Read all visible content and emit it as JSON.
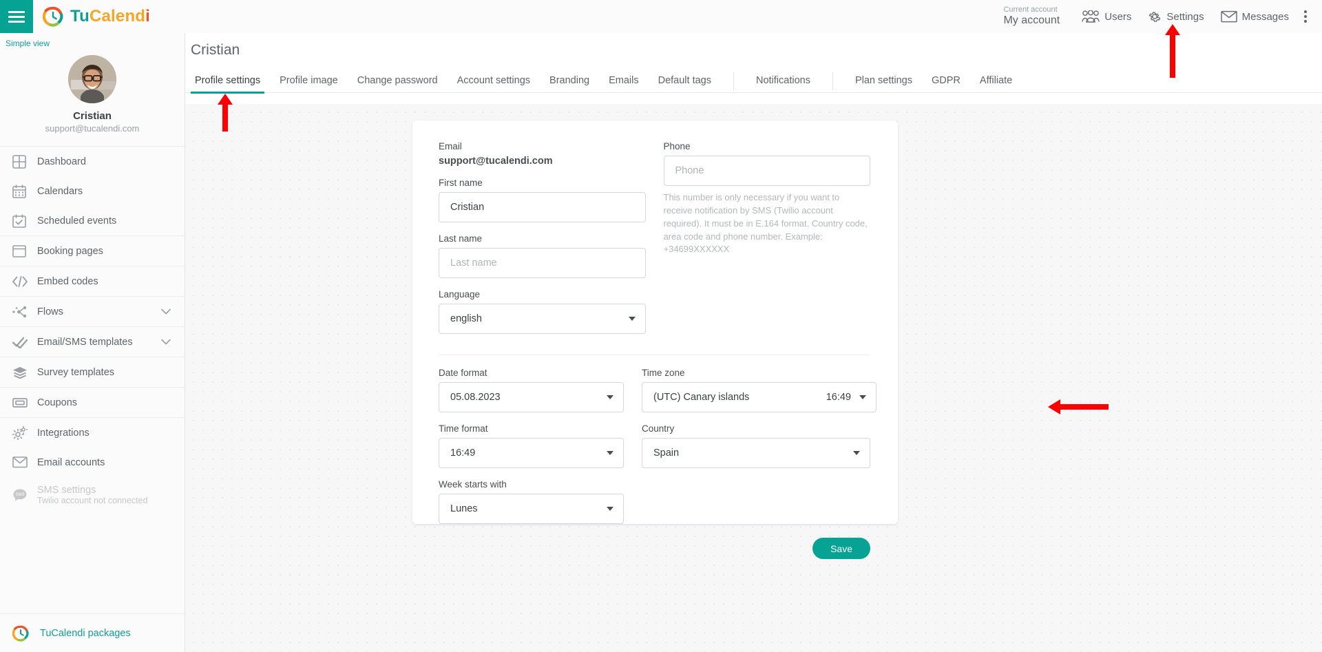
{
  "brand": {
    "part1": "Tu",
    "part2": "Calend",
    "part3": "i"
  },
  "topbar": {
    "menu_label": "menu",
    "current_account_caption": "Current account",
    "current_account_value": "My account",
    "items": [
      {
        "label": "Users",
        "icon": "users-icon"
      },
      {
        "label": "Settings",
        "icon": "gear-icon"
      },
      {
        "label": "Messages",
        "icon": "envelope-icon"
      }
    ],
    "more_label": "More options"
  },
  "sidebar": {
    "simple_view": "Simple view",
    "profile": {
      "name": "Cristian",
      "email": "support@tucalendi.com"
    },
    "items": [
      {
        "label": "Dashboard",
        "icon": "dashboard-icon",
        "chevron": false,
        "disabled": false,
        "sep_after": false
      },
      {
        "label": "Calendars",
        "icon": "calendar-icon",
        "chevron": false,
        "disabled": false,
        "sep_after": false
      },
      {
        "label": "Scheduled events",
        "icon": "calendar-check-icon",
        "chevron": false,
        "disabled": false,
        "sep_after": true
      },
      {
        "label": "Booking pages",
        "icon": "window-icon",
        "chevron": false,
        "disabled": false,
        "sep_after": true
      },
      {
        "label": "Embed codes",
        "icon": "code-icon",
        "chevron": false,
        "disabled": false,
        "sep_after": true
      },
      {
        "label": "Flows",
        "icon": "flow-icon",
        "chevron": true,
        "disabled": false,
        "sep_after": true
      },
      {
        "label": "Email/SMS templates",
        "icon": "double-check-icon",
        "chevron": true,
        "disabled": false,
        "sep_after": true
      },
      {
        "label": "Survey templates",
        "icon": "layers-icon",
        "chevron": false,
        "disabled": false,
        "sep_after": true
      },
      {
        "label": "Coupons",
        "icon": "ticket-icon",
        "chevron": false,
        "disabled": false,
        "sep_after": true
      },
      {
        "label": "Integrations",
        "icon": "gears-icon",
        "chevron": false,
        "disabled": false,
        "sep_after": false
      },
      {
        "label": "Email accounts",
        "icon": "envelope-icon",
        "chevron": false,
        "disabled": false,
        "sep_after": false
      }
    ],
    "sms": {
      "label": "SMS settings",
      "sublabel": "Twilio account not connected"
    },
    "footer": {
      "label": "TuCalendi packages",
      "icon": "tucalendi-logo-icon"
    }
  },
  "page": {
    "title": "Cristian",
    "tabs": [
      {
        "label": "Profile settings",
        "active": true
      },
      {
        "label": "Profile image",
        "active": false
      },
      {
        "label": "Change password",
        "active": false
      },
      {
        "label": "Account settings",
        "active": false
      },
      {
        "label": "Branding",
        "active": false
      },
      {
        "label": "Emails",
        "active": false
      },
      {
        "label": "Default tags",
        "active": false
      },
      {
        "label": "Notifications",
        "active": false
      },
      {
        "label": "Plan settings",
        "active": false
      },
      {
        "label": "GDPR",
        "active": false
      },
      {
        "label": "Affiliate",
        "active": false
      }
    ]
  },
  "form": {
    "email": {
      "label": "Email",
      "value": "support@tucalendi.com"
    },
    "first_name": {
      "label": "First name",
      "value": "Cristian",
      "placeholder": "First name"
    },
    "last_name": {
      "label": "Last name",
      "value": "",
      "placeholder": "Last name"
    },
    "language": {
      "label": "Language",
      "value": "english"
    },
    "phone": {
      "label": "Phone",
      "value": "",
      "placeholder": "Phone",
      "help": "This number is only necessary if you want to receive notification by SMS (Twilio account required). It must be in E.164 format. Country code, area code and phone number. Example: +34699XXXXXX"
    },
    "date_format": {
      "label": "Date format",
      "value": "05.08.2023"
    },
    "time_format": {
      "label": "Time format",
      "value": "16:49"
    },
    "week_starts_with": {
      "label": "Week starts with",
      "value": "Lunes"
    },
    "time_zone": {
      "label": "Time zone",
      "value": "(UTC) Canary islands",
      "extra": "16:49"
    },
    "country": {
      "label": "Country",
      "value": "Spain"
    },
    "save_label": "Save"
  },
  "annotations": {
    "arrow_color": "#FF0000",
    "arrows": [
      {
        "name": "arrow-settings",
        "points_to": "Settings"
      },
      {
        "name": "arrow-profile-settings-tab",
        "points_to": "Profile settings"
      },
      {
        "name": "arrow-time-zone",
        "points_to": "Time zone"
      }
    ]
  },
  "colors": {
    "accent": "#06a294",
    "orange": "#f5a623",
    "red": "#e8552a",
    "text": "#5f6368"
  }
}
